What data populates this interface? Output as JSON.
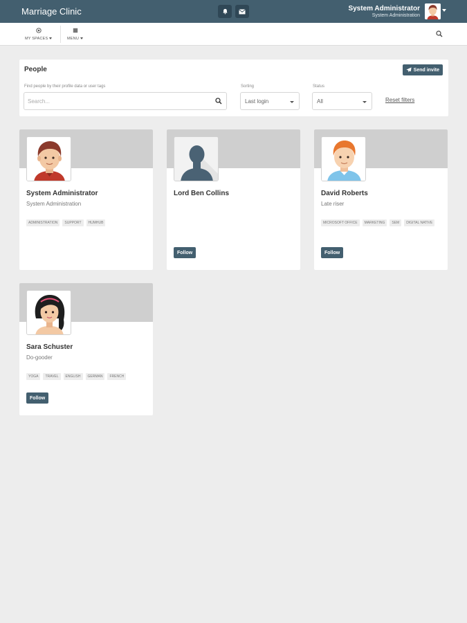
{
  "app": {
    "title": "Marriage Clinic"
  },
  "user": {
    "name": "System Administrator",
    "subtitle": "System Administration"
  },
  "nav": {
    "my_spaces": "MY SPACES",
    "menu": "MENU"
  },
  "panel": {
    "title": "People",
    "invite_label": "Send invite",
    "search_label": "Find people by their profile data or user tags",
    "search_placeholder": "Search...",
    "sorting_label": "Sorting",
    "sorting_value": "Last login",
    "status_label": "Status",
    "status_value": "All",
    "reset_label": "Reset filters"
  },
  "follow_label": "Follow",
  "people": [
    {
      "name": "System Administrator",
      "title": "System Administration",
      "tags": [
        "Administration",
        "Support",
        "HumHub"
      ]
    },
    {
      "name": "Lord Ben Collins",
      "title": "",
      "tags": []
    },
    {
      "name": "David Roberts",
      "title": "Late riser",
      "tags": [
        "Microsoft Office",
        "Marketing",
        "SEM",
        "Digital Native"
      ]
    },
    {
      "name": "Sara Schuster",
      "title": "Do-gooder",
      "tags": [
        "Yoga",
        "Travel",
        "English",
        "German",
        "French"
      ]
    }
  ],
  "colors": {
    "header": "#435f6f",
    "banner": "#cfcfcf",
    "background": "#ededed"
  }
}
